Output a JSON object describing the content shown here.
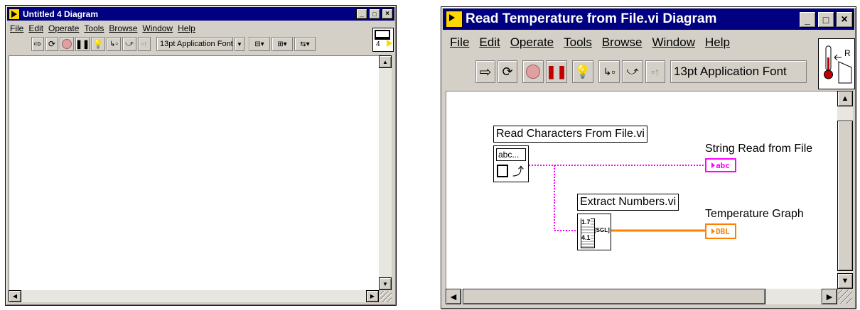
{
  "left_window": {
    "title": "Untitled 4 Diagram",
    "menu": [
      "File",
      "Edit",
      "Operate",
      "Tools",
      "Browse",
      "Window",
      "Help"
    ],
    "font_selector": "13pt Application Font",
    "icon_number": "4"
  },
  "right_window": {
    "title": "Read Temperature from File.vi Diagram",
    "menu": [
      "File",
      "Edit",
      "Operate",
      "Tools",
      "Browse",
      "Window",
      "Help"
    ],
    "font_selector": "13pt Application Font",
    "diagram": {
      "read_node_label": "Read Characters From File.vi",
      "read_node_glyph": "abc...",
      "extract_node_label": "Extract Numbers.vi",
      "extract_node_glyph_top": "1.7",
      "extract_node_glyph_bottom": "4.1",
      "extract_node_type": "[SGL]",
      "string_indicator_label": "String Read from File",
      "string_terminal_text": "abc",
      "graph_indicator_label": "Temperature Graph",
      "graph_terminal_text": "DBL",
      "string_wire_color": "#ff00ff",
      "numeric_wire_color": "#ff8000"
    }
  }
}
